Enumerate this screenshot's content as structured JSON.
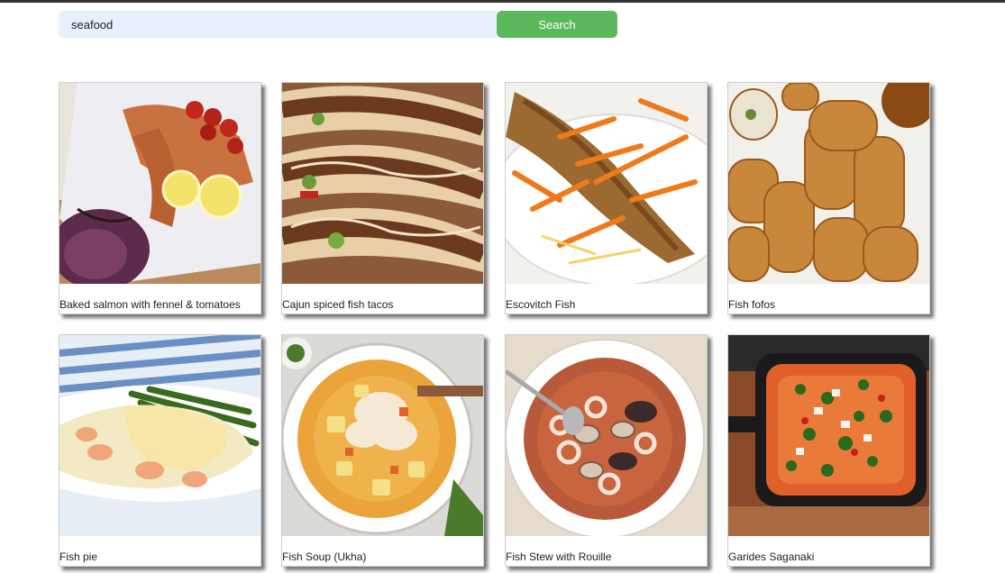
{
  "search": {
    "value": "seafood",
    "button_label": "Search"
  },
  "colors": {
    "button": "#5cb85c",
    "input_bg": "#e8f0fe"
  },
  "recipes": [
    {
      "title": "Baked salmon with fennel & tomatoes",
      "icon": "salmon-dish-image"
    },
    {
      "title": "Cajun spiced fish tacos",
      "icon": "fish-tacos-image"
    },
    {
      "title": "Escovitch Fish",
      "icon": "escovitch-fish-image"
    },
    {
      "title": "Fish fofos",
      "icon": "fish-fofos-image"
    },
    {
      "title": "Fish pie",
      "icon": "fish-pie-image"
    },
    {
      "title": "Fish Soup (Ukha)",
      "icon": "fish-soup-image"
    },
    {
      "title": "Fish Stew with Rouille",
      "icon": "fish-stew-image"
    },
    {
      "title": "Garides Saganaki",
      "icon": "garides-saganaki-image"
    }
  ]
}
